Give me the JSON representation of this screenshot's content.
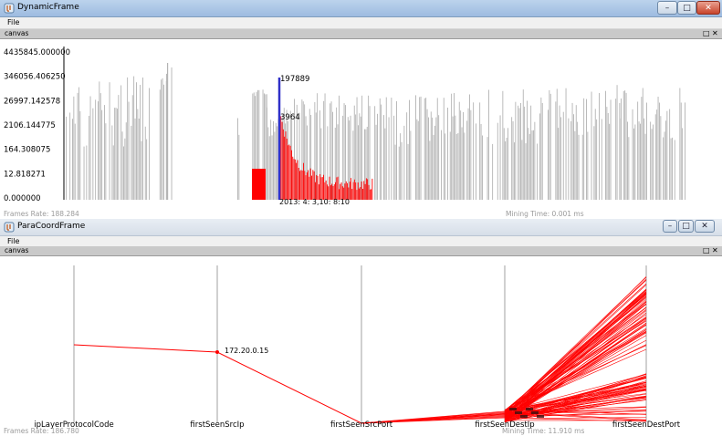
{
  "window1": {
    "title": "DynamicFrame",
    "menu": {
      "file": "File"
    },
    "canvas": {
      "label": "canvas"
    },
    "status": {
      "frame_rate": "Frames Rate: 188.284",
      "mining_time": "Mining Time: 0.001 ms"
    }
  },
  "window2": {
    "title": "ParaCoordFrame",
    "menu": {
      "file": "File"
    },
    "canvas": {
      "label": "canvas"
    },
    "status": {
      "frame_rate": "Frames Rate: 186.780",
      "mining_time": "Mining Time: 11.910 ms"
    }
  },
  "chart_data": [
    {
      "type": "bar",
      "y_tick_labels": [
        "4435845.000000",
        "346056.406250",
        "26997.142578",
        "2106.144775",
        "164.308075",
        "12.818271",
        "0.000000"
      ],
      "annotations": [
        "197889",
        "3964",
        "2013: 4: 3,10: 8:10"
      ],
      "series": [
        {
          "color": "#b3b3b3"
        },
        {
          "color": "#ff0000"
        }
      ],
      "highlight_color": "#3030c8"
    },
    {
      "type": "parallel-coordinates",
      "axes": [
        "ipLayerProtocolCode",
        "firstSeenSrcIp",
        "firstSeenSrcPort",
        "firstSeenDestIp",
        "firstSeenDestPort"
      ],
      "annotations": [
        "172.20.0.15"
      ],
      "line_color": "#ff0000"
    }
  ]
}
